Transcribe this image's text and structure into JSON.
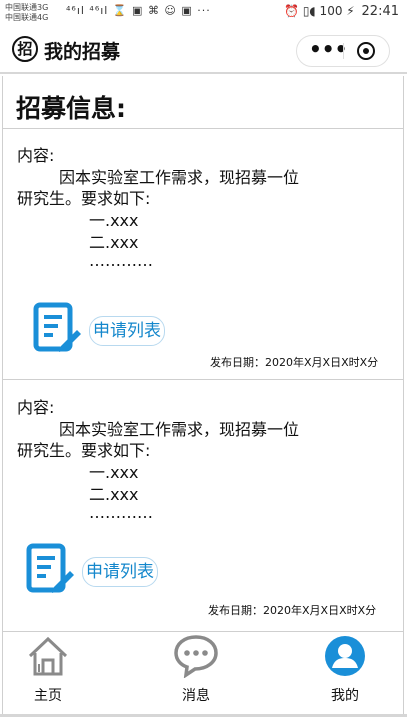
{
  "status_bar": {
    "carrier1": "中国联通3G",
    "carrier2": "中国联通4G",
    "icons_text": "⁴⁶ıl ⁴⁶ıl  ⌛ ▣ ⌘ ☺ ▣ ···",
    "right_icons_text": "⏰ ▯◖ 100 ⚡",
    "time": "22:41"
  },
  "navbar": {
    "logo_char": "招",
    "title": "我的招募"
  },
  "page": {
    "section_title": "招募信息:"
  },
  "posts": [
    {
      "content_label": "内容:",
      "line1": "因本实验室工作需求，现招募一位",
      "line2": "研究生。要求如下:",
      "req1": "一.xxx",
      "req2": "二.xxx",
      "req3": "…………",
      "apply_label": "申请列表",
      "publish_date": "发布日期：2020年X月X日X时X分"
    },
    {
      "content_label": "内容:",
      "line1": "因本实验室工作需求，现招募一位",
      "line2": "研究生。要求如下:",
      "req1": "一.xxx",
      "req2": "二.xxx",
      "req3": "…………",
      "apply_label": "申请列表",
      "publish_date": "发布日期：2020年X月X日X时X分"
    }
  ],
  "tabbar": {
    "home": "主页",
    "messages": "消息",
    "mine": "我的"
  },
  "colors": {
    "accent": "#1a8fd8",
    "icon_gray": "#8a8a8a"
  }
}
